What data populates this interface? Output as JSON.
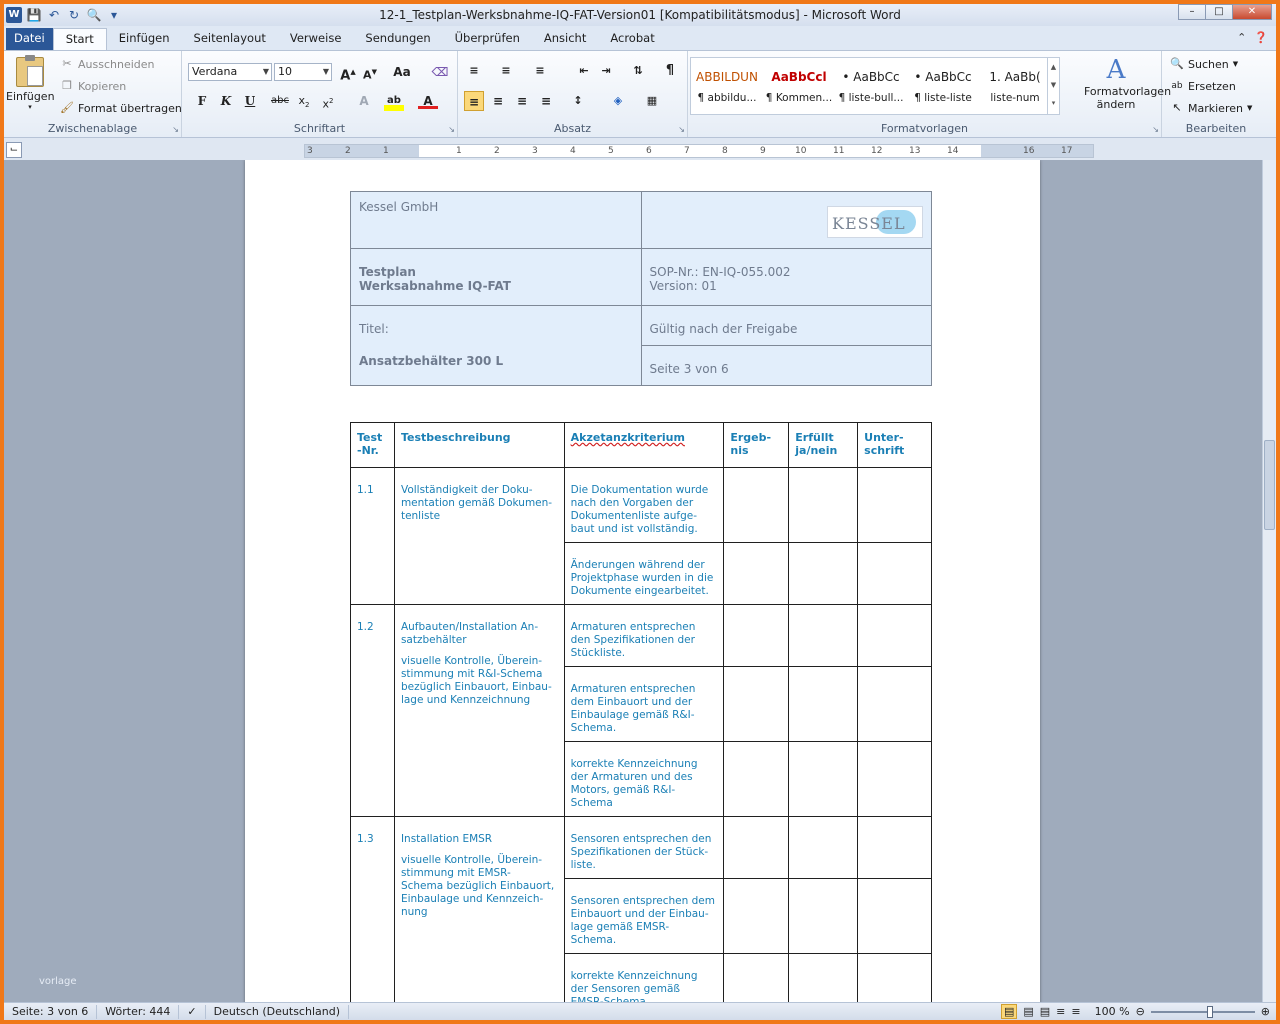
{
  "window": {
    "title": "12-1_Testplan-Werksbnahme-IQ-FAT-Version01 [Kompatibilitätsmodus] - Microsoft Word"
  },
  "tabs": [
    "Datei",
    "Start",
    "Einfügen",
    "Seitenlayout",
    "Verweise",
    "Sendungen",
    "Überprüfen",
    "Ansicht",
    "Acrobat"
  ],
  "ribbon": {
    "clipboard": {
      "paste": "Einfügen",
      "cut": "Ausschneiden",
      "copy": "Kopieren",
      "format_painter": "Format übertragen",
      "label": "Zwischenablage"
    },
    "font": {
      "name": "Verdana",
      "size": "10",
      "label": "Schriftart"
    },
    "paragraph": {
      "label": "Absatz"
    },
    "styles": {
      "items": [
        {
          "preview": "ABBILDUN",
          "name": "¶ abbildu...",
          "color": "#c05000"
        },
        {
          "preview": "AaBbCcl",
          "name": "¶ Kommen...",
          "color": "#c00000"
        },
        {
          "preview": "• AaBbCc",
          "name": "¶ liste-bull...",
          "color": "#222222"
        },
        {
          "preview": "• AaBbCc",
          "name": "¶ liste-liste",
          "color": "#222222"
        },
        {
          "preview": "1.  AaBb(",
          "name": "liste-num",
          "color": "#222222"
        }
      ],
      "change": "Formatvorlagen ändern",
      "label": "Formatvorlagen"
    },
    "editing": {
      "find": "Suchen",
      "replace": "Ersetzen",
      "select": "Markieren",
      "label": "Bearbeiten"
    }
  },
  "ruler": {
    "numbers": [
      "3",
      "2",
      "1",
      "1",
      "2",
      "3",
      "4",
      "5",
      "6",
      "7",
      "8",
      "9",
      "10",
      "11",
      "12",
      "13",
      "14",
      "16",
      "17"
    ]
  },
  "header_table": {
    "company": "Kessel GmbH",
    "logo_text": "KESSEL",
    "doc_type": "Testplan",
    "doc_name": "Werksabnahme IQ-FAT",
    "sop_label": "SOP-Nr.: EN-IQ-055.002",
    "version_label": "Version:  01",
    "title_label": "Titel:",
    "title_value": "Ansatzbehälter 300 L",
    "valid": "Gültig  nach  der Freigabe",
    "page": "Seite  3 von 6"
  },
  "main_table": {
    "headers": {
      "nr": "Test\n-Nr.",
      "desc": "Testbeschreibung",
      "crit": "Akzetanzkriterium",
      "result": "Ergeb-\nnis",
      "fulfilled": "Erfüllt\nja/nein",
      "sign": "Unter-\nschrift"
    },
    "rows": [
      {
        "nr": "1.1",
        "desc": "Vollständigkeit der Doku-\nmentation gemäß Dokumen-\ntenliste",
        "desc2": "",
        "criteria": [
          "Die Dokumentation wurde\nnach den Vorgaben der\nDokumentenliste aufge-\nbaut und ist vollständig.",
          "Änderungen während der\nProjektphase wurden in die\nDokumente eingearbeitet."
        ]
      },
      {
        "nr": "1.2",
        "desc": "Aufbauten/Installation An-\nsatzbehälter",
        "desc2": "visuelle Kontrolle, Überein-\nstimmung mit R&I-Schema\nbezüglich Einbauort, Einbau-\nlage und Kennzeichnung",
        "criteria": [
          "Armaturen entsprechen\nden Spezifikationen der\nStückliste.",
          "Armaturen entsprechen\ndem Einbauort und der\nEinbaulage gemäß R&I-\nSchema.",
          "korrekte Kennzeichnung\nder Armaturen und des\nMotors, gemäß R&I-\nSchema"
        ]
      },
      {
        "nr": "1.3",
        "desc": "Installation EMSR",
        "desc2": "visuelle Kontrolle, Überein-\nstimmung mit EMSR-\nSchema bezüglich Einbauort,\nEinbaulage und Kennzeich-\nnung",
        "criteria": [
          "Sensoren entsprechen den\nSpezifikationen der Stück-\nliste.",
          "Sensoren entsprechen dem\nEinbauort und der Einbau-\nlage gemäß EMSR-\nSchema.",
          "korrekte Kennzeichnung\nder Sensoren gemäß\nEMSR-Schema"
        ]
      }
    ]
  },
  "watermark": "vorlage",
  "status": {
    "page": "Seite: 3 von 6",
    "words": "Wörter: 444",
    "language": "Deutsch (Deutschland)",
    "zoom": "100 %"
  },
  "colors": {
    "accent": "#2b5797",
    "doc_text": "#1a7fb5",
    "header_bg": "#e2eefb",
    "frame": "#f07818"
  }
}
